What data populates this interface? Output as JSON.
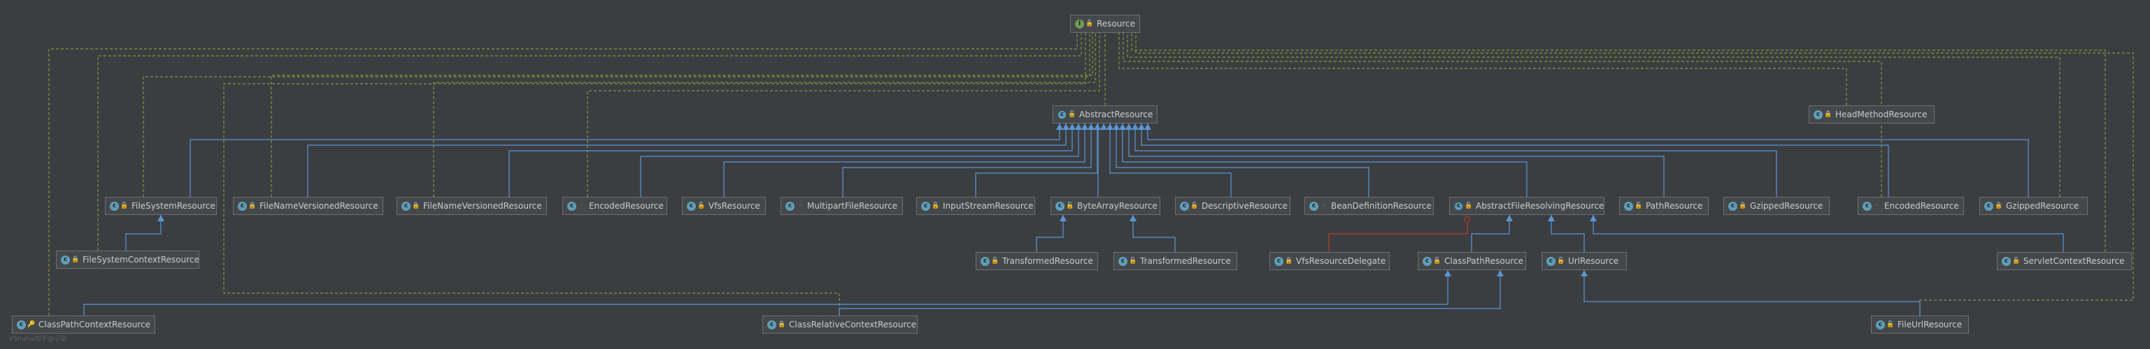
{
  "nodes": {
    "resource": {
      "name": "Resource",
      "kind": "interface",
      "vis": "public"
    },
    "abstract_resource": {
      "name": "AbstractResource",
      "kind": "abstract",
      "vis": "public"
    },
    "head_method_resource": {
      "name": "HeadMethodResource",
      "kind": "class",
      "vis": "private"
    },
    "file_system_resource": {
      "name": "FileSystemResource",
      "kind": "class",
      "vis": "public"
    },
    "file_name_versioned_resource_1": {
      "name": "FileNameVersionedResource",
      "kind": "class",
      "vis": "private"
    },
    "file_name_versioned_resource_2": {
      "name": "FileNameVersionedResource",
      "kind": "class",
      "vis": "private"
    },
    "encoded_resource_1": {
      "name": "EncodedResource",
      "kind": "class",
      "vis": "package"
    },
    "vfs_resource": {
      "name": "VfsResource",
      "kind": "class",
      "vis": "public"
    },
    "multipart_file_resource": {
      "name": "MultipartFileResource",
      "kind": "class",
      "vis": "package"
    },
    "input_stream_resource": {
      "name": "InputStreamResource",
      "kind": "class",
      "vis": "public"
    },
    "byte_array_resource": {
      "name": "ByteArrayResource",
      "kind": "class",
      "vis": "public"
    },
    "descriptive_resource": {
      "name": "DescriptiveResource",
      "kind": "class",
      "vis": "public"
    },
    "bean_definition_resource": {
      "name": "BeanDefinitionResource",
      "kind": "class",
      "vis": "package"
    },
    "abstract_file_resolving_resource": {
      "name": "AbstractFileResolvingResource",
      "kind": "abstract",
      "vis": "public"
    },
    "path_resource": {
      "name": "PathResource",
      "kind": "class",
      "vis": "public"
    },
    "gzipped_resource_1": {
      "name": "GzippedResource",
      "kind": "class",
      "vis": "private"
    },
    "encoded_resource_2": {
      "name": "EncodedResource",
      "kind": "class",
      "vis": "package"
    },
    "gzipped_resource_2": {
      "name": "GzippedResource",
      "kind": "class",
      "vis": "private"
    },
    "file_system_context_resource": {
      "name": "FileSystemContextResource",
      "kind": "class",
      "vis": "private"
    },
    "transformed_resource_1": {
      "name": "TransformedResource",
      "kind": "class",
      "vis": "public"
    },
    "transformed_resource_2": {
      "name": "TransformedResource",
      "kind": "class",
      "vis": "public"
    },
    "vfs_resource_delegate": {
      "name": "VfsResourceDelegate",
      "kind": "class",
      "vis": "private"
    },
    "class_path_resource": {
      "name": "ClassPathResource",
      "kind": "class",
      "vis": "public"
    },
    "url_resource": {
      "name": "UrlResource",
      "kind": "class",
      "vis": "public"
    },
    "servlet_context_resource": {
      "name": "ServletContextResource",
      "kind": "class",
      "vis": "public"
    },
    "class_path_context_resource": {
      "name": "ClassPathContextResource",
      "kind": "class",
      "vis": "protected"
    },
    "class_relative_context_resource": {
      "name": "ClassRelativeContextResource",
      "kind": "class",
      "vis": "private"
    },
    "file_url_resource": {
      "name": "FileUrlResource",
      "kind": "class",
      "vis": "public"
    }
  },
  "legend": {
    "kind_letters": {
      "class": "c",
      "abstract": "c",
      "interface": "I"
    },
    "vis_glyphs": {
      "public": "🔓",
      "private": "🔒",
      "protected": "🔑",
      "package": "◦"
    }
  },
  "colors": {
    "background": "#3b3e41",
    "extends_edge": "#5b95d6",
    "implements_edge": "#7d9a3b",
    "inner_class_edge": "#c0392b",
    "node_fill": "#45484a",
    "node_border": "#6c7073"
  },
  "watermark": "#Shuhai知乎@小柒"
}
